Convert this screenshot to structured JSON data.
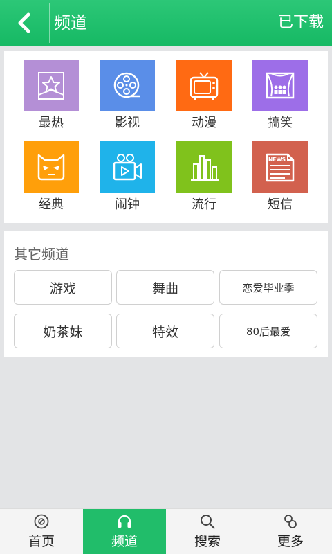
{
  "header": {
    "title": "频道",
    "downloaded_label": "已下载"
  },
  "channels": [
    {
      "label": "最热",
      "icon": "star-icon",
      "color": "#b48fd6"
    },
    {
      "label": "影视",
      "icon": "film-reel-icon",
      "color": "#5a8ee8"
    },
    {
      "label": "动漫",
      "icon": "tv-icon",
      "color": "#ff6a13"
    },
    {
      "label": "搞笑",
      "icon": "stage-icon",
      "color": "#9d6ee8"
    },
    {
      "label": "经典",
      "icon": "demon-face-icon",
      "color": "#ff9f0a"
    },
    {
      "label": "闹钟",
      "icon": "video-camera-icon",
      "color": "#1fb3ea"
    },
    {
      "label": "流行",
      "icon": "bar-chart-icon",
      "color": "#80c21c"
    },
    {
      "label": "短信",
      "icon": "newspaper-icon",
      "color": "#d2614e"
    }
  ],
  "newspaper_text": "NEWS",
  "other": {
    "title": "其它频道",
    "tags": [
      "游戏",
      "舞曲",
      "恋爱毕业季",
      "奶茶妹",
      "特效",
      "80后最爱"
    ]
  },
  "tabs": [
    {
      "label": "首页",
      "icon": "disc-icon",
      "active": false
    },
    {
      "label": "频道",
      "icon": "headphones-icon",
      "active": true
    },
    {
      "label": "搜索",
      "icon": "search-icon",
      "active": false
    },
    {
      "label": "更多",
      "icon": "more-icon",
      "active": false
    }
  ],
  "colors": {
    "brand": "#1fbf6e",
    "active_tab": "#21bd6a"
  }
}
